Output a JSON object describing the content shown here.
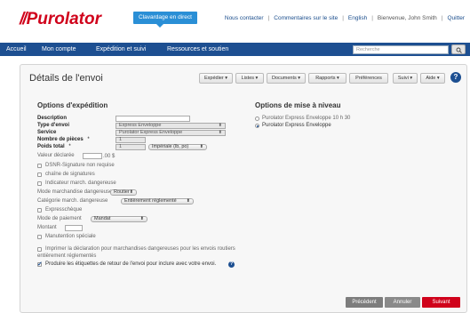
{
  "brand": {
    "logo_text": "Purolator",
    "accent": "#d0021b",
    "nav_color": "#1d4f91"
  },
  "header": {
    "chat": "Clavardage en direct",
    "links": [
      "Nous contacter",
      "Commentaires sur le site",
      "English"
    ],
    "welcome": "Bienvenue, John Smith",
    "logout": "Quitter"
  },
  "nav": {
    "items": [
      "Accueil",
      "Mon compte",
      "Expédition et suivi",
      "Ressources et soutien"
    ],
    "search_placeholder": "Recherche"
  },
  "page": {
    "title": "Détails de l'envoi",
    "tabs": [
      "Expédier ▾",
      "Listes ▾",
      "Documents ▾",
      "Rapports ▾",
      "Préférences",
      "Suivi ▾",
      "Aide ▾"
    ]
  },
  "shipping": {
    "title": "Options d'expédition",
    "description_label": "Description",
    "type_label": "Type d'envoi",
    "type_value": "Express Enveloppe",
    "service_label": "Service",
    "service_value": "Purolator Express Enveloppe",
    "pieces_label": "Nombre de pièces",
    "pieces_value": "1",
    "weight_label": "Poids total",
    "weight_value": "1",
    "weight_unit": "Impériale (lb, po)",
    "required_mark": "*",
    "declared_label": "Valeur déclarée",
    "declared_suffix": ".00 $",
    "dsnr": "DSNR-Signature non requise",
    "chain": "chaîne de signatures",
    "dangerous_ind": "Indicateur march. dangereuse",
    "dangerous_mode_label": "Mode marchandise dangereuse",
    "dangerous_mode_value": "Routier",
    "dangerous_cat_label": "Catégorie march. dangereuse",
    "dangerous_cat_value": "Entièrement réglementé",
    "expresscheque": "Expresschèque",
    "payment_label": "Mode de paiement",
    "payment_value": "Mandat",
    "amount_label": "Montant",
    "special": "Manutention spéciale",
    "print_decl_1": "Imprimer la déclaration pour marchandises dangereuses pour les envois routiers",
    "print_decl_2": "entièrement réglementés",
    "return_labels": "Produire les étiquettes de retour de l'envoi pour inclure avec votre envoi."
  },
  "upgrade": {
    "title": "Options de mise à niveau",
    "options": [
      "Purolator Express Enveloppe 10 h 30",
      "Purolator Express Enveloppe"
    ],
    "selected": 1
  },
  "buttons": {
    "previous": "Précédent",
    "cancel": "Annuler",
    "next": "Suivant"
  }
}
